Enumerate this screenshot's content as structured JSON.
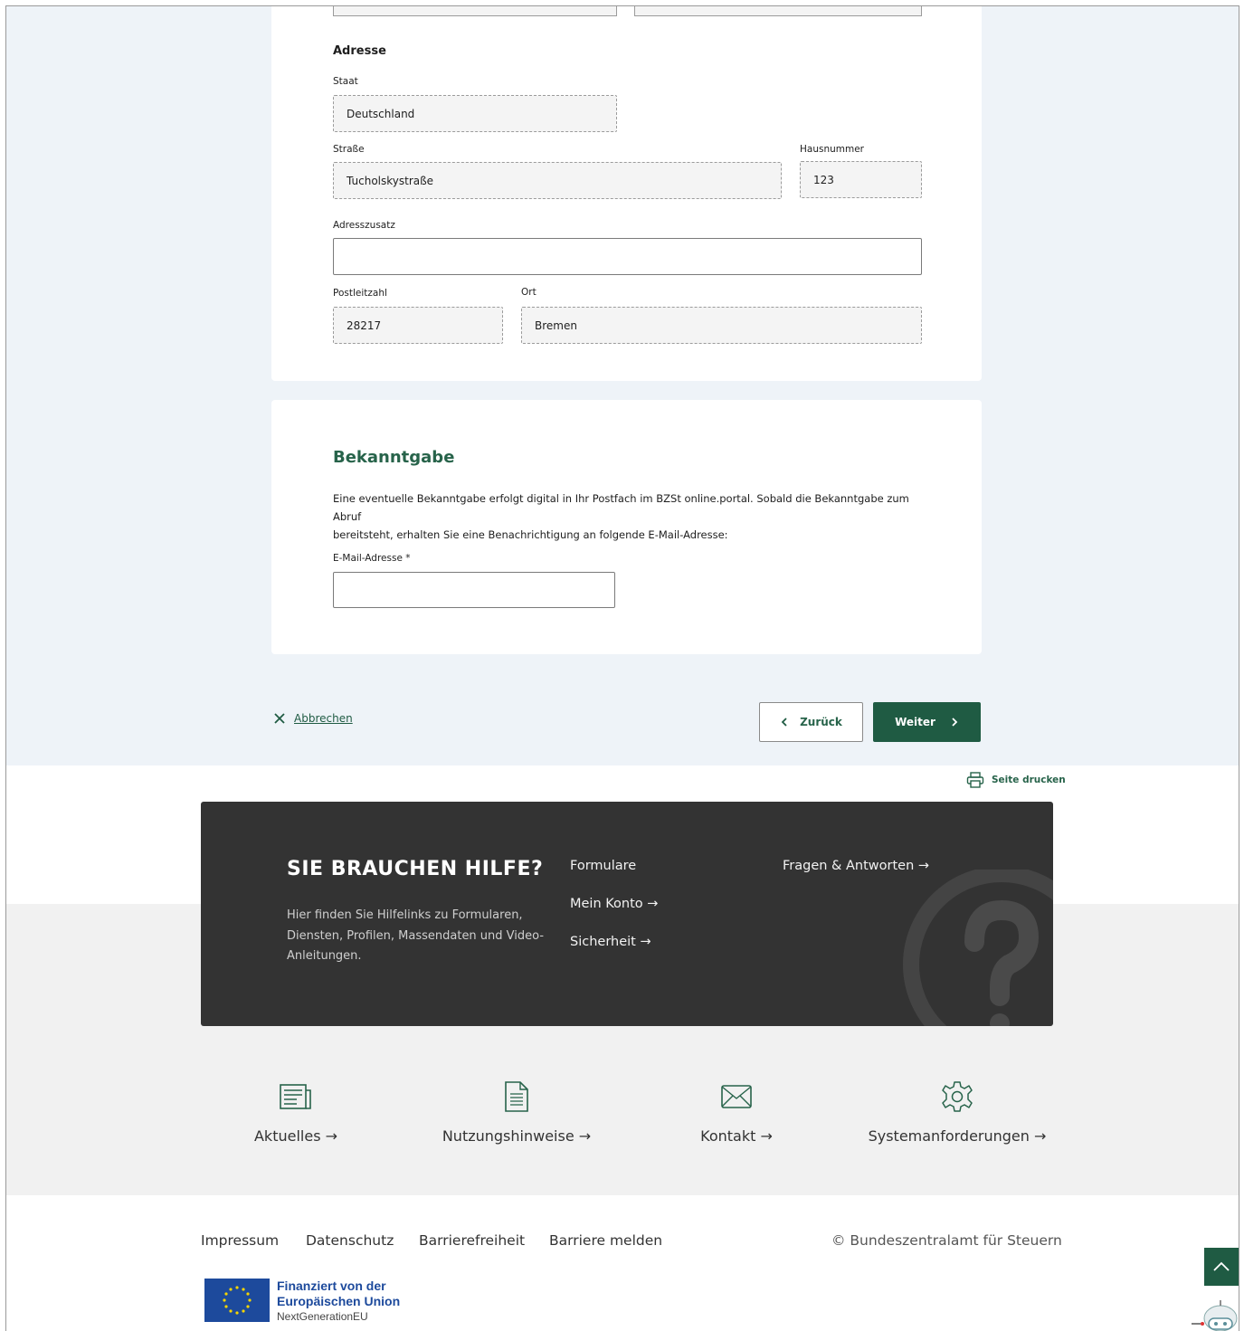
{
  "address": {
    "heading": "Adresse",
    "country_label": "Staat",
    "country_value": "Deutschland",
    "street_label": "Straße",
    "street_value": "Tucholskystraße",
    "house_number_label": "Hausnummer",
    "house_number_value": "123",
    "address_extra_label": "Adresszusatz",
    "address_extra_value": "",
    "postcode_label": "Postleitzahl",
    "postcode_value": "28217",
    "city_label": "Ort",
    "city_value": "Bremen"
  },
  "notification": {
    "heading": "Bekanntgabe",
    "text_line1": "Eine eventuelle Bekanntgabe erfolgt digital in Ihr Postfach im BZSt online.portal. Sobald die Bekanntgabe zum Abruf",
    "text_line2": "bereitsteht, erhalten Sie eine Benachrichtigung an folgende E-Mail-Adresse:",
    "email_label": "E-Mail-Adresse *",
    "email_value": ""
  },
  "actions": {
    "cancel_label": "Abbrechen",
    "back_label": "Zurück",
    "next_label": "Weiter",
    "print_label": "Seite drucken"
  },
  "help": {
    "title": "SIE BRAUCHEN HILFE?",
    "text": "Hier finden Sie Hilfelinks zu Formularen, Diensten, Profilen, Massendaten und Video-Anleitungen.",
    "links": [
      "Formulare",
      "Mein Konto →",
      "Sicherheit →",
      "Fragen & Antworten →"
    ]
  },
  "services": [
    {
      "label": "Aktuelles →",
      "icon": "newspaper-icon"
    },
    {
      "label": "Nutzungshinweise →",
      "icon": "document-icon"
    },
    {
      "label": "Kontakt →",
      "icon": "envelope-icon"
    },
    {
      "label": "Systemanforderungen →",
      "icon": "gear-icon"
    }
  ],
  "footer": {
    "links": [
      "Impressum",
      "Datenschutz",
      "Barrierefreiheit",
      "Barriere melden"
    ],
    "copyright": "© Bundeszentralamt für Steuern",
    "eu_line1": "Finanziert von der",
    "eu_line2": "Europäischen Union",
    "eu_line3": "NextGenerationEU"
  },
  "colors": {
    "brand_green": "#1f5b43",
    "heading_green": "#27634a",
    "page_bg": "#eef3f8",
    "help_bg": "#333333",
    "eu_blue": "#1d4a9c"
  }
}
